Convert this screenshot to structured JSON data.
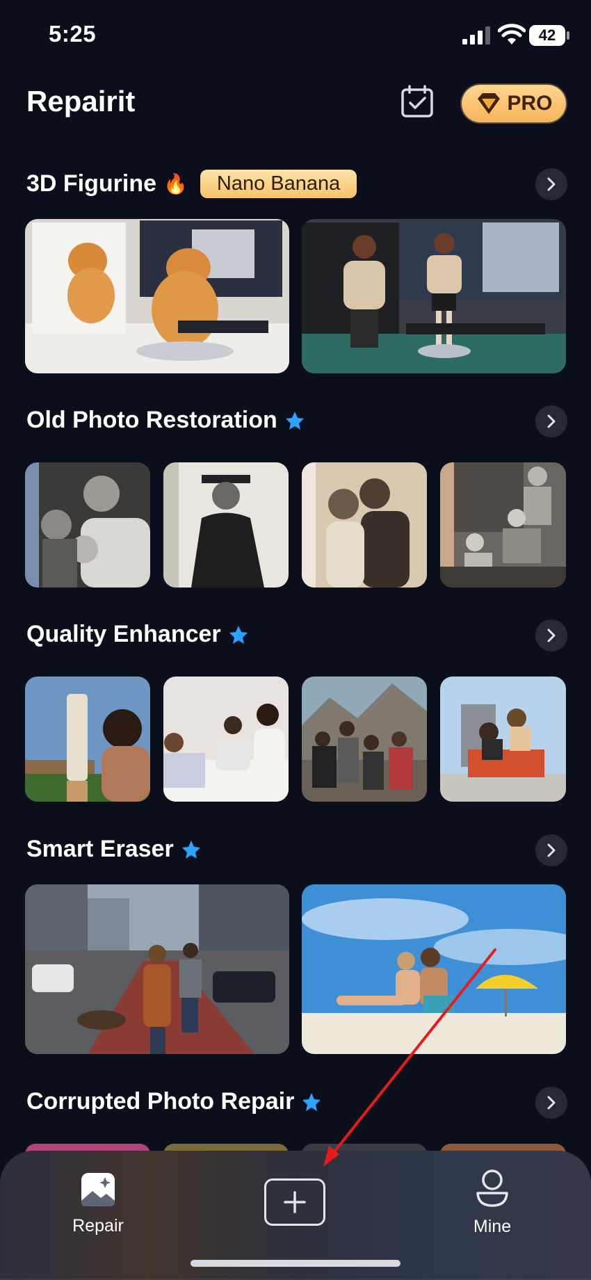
{
  "status_bar": {
    "time": "5:25",
    "battery": "42",
    "icons": [
      "cellular-signal-icon",
      "wifi-icon",
      "battery-icon"
    ]
  },
  "header": {
    "title": "Repairit",
    "pro_label": "PRO",
    "icons": [
      "calendar-check-icon",
      "diamond-icon"
    ]
  },
  "sections": [
    {
      "title": "3D Figurine",
      "emoji": "🔥",
      "badge": "Nano Banana",
      "thumbnails": 2
    },
    {
      "title": "Old Photo Restoration",
      "thumbnails": 4
    },
    {
      "title": "Quality Enhancer",
      "thumbnails": 4
    },
    {
      "title": "Smart Eraser",
      "thumbnails": 2
    },
    {
      "title": "Corrupted Photo Repair",
      "thumbnails": 4
    }
  ],
  "tab_bar": {
    "repair_label": "Repair",
    "mine_label": "Mine"
  },
  "colors": {
    "background": "#0b0f1c",
    "pro_gradient_start": "#ffd58d",
    "pro_gradient_end": "#f7b45a",
    "star_accent": "#2aa4ff",
    "annotation_arrow": "#e61c1c"
  }
}
